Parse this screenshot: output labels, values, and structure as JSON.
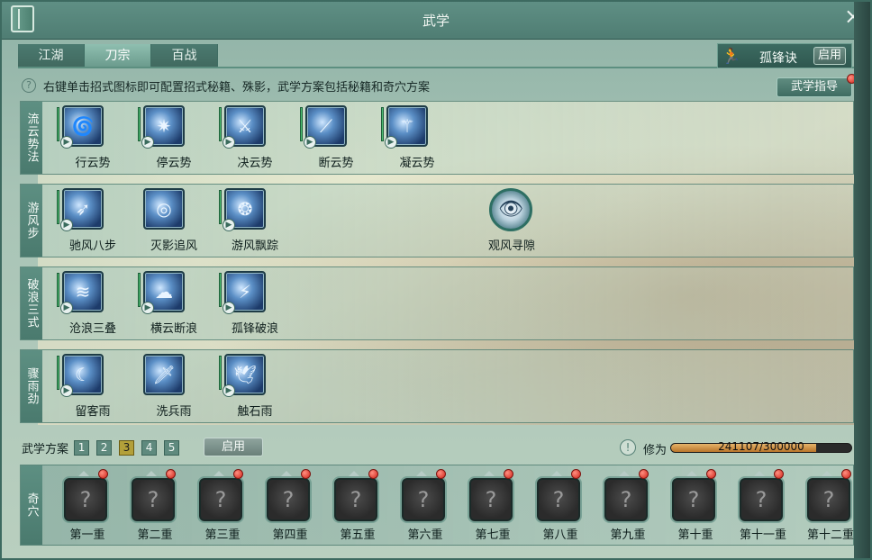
{
  "window": {
    "title": "武学"
  },
  "tabs": [
    {
      "label": "江湖",
      "active": false
    },
    {
      "label": "刀宗",
      "active": true
    },
    {
      "label": "百战",
      "active": false
    }
  ],
  "heart_method": {
    "name": "孤锋诀",
    "enable_label": "启用",
    "icon": "runner-icon"
  },
  "hint": {
    "text": "右键单击招式图标即可配置招式秘籍、殊影，武学方案包括秘籍和奇穴方案"
  },
  "guide_button": {
    "label": "武学指导"
  },
  "sections": [
    {
      "label": "流云势法",
      "skills": [
        "行云势",
        "停云势",
        "决云势",
        "断云势",
        "凝云势"
      ]
    },
    {
      "label": "游风步",
      "skills": [
        "驰风八步",
        "灭影追风",
        "游风飘踪"
      ],
      "extra_skill": "观风寻隙"
    },
    {
      "label": "破浪三式",
      "skills": [
        "沧浪三叠",
        "横云断浪",
        "孤锋破浪"
      ]
    },
    {
      "label": "骤雨劲",
      "skills": [
        "留客雨",
        "洗兵雨",
        "触石雨"
      ]
    }
  ],
  "scheme": {
    "label": "武学方案",
    "options": [
      "1",
      "2",
      "3",
      "4",
      "5"
    ],
    "selected": "3",
    "enable_label": "启用"
  },
  "cultivation": {
    "label": "修为",
    "value_text": "241107/300000",
    "current": 241107,
    "max": 300000
  },
  "qixue": {
    "label": "奇穴",
    "points": [
      "第一重",
      "第二重",
      "第三重",
      "第四重",
      "第五重",
      "第六重",
      "第七重",
      "第八重",
      "第九重",
      "第十重",
      "第十一重",
      "第十二重"
    ],
    "locked_glyph": "?"
  },
  "colors": {
    "accent": "#5d8f82",
    "progress": "#d19a52",
    "alert_dot": "#d0241a"
  }
}
